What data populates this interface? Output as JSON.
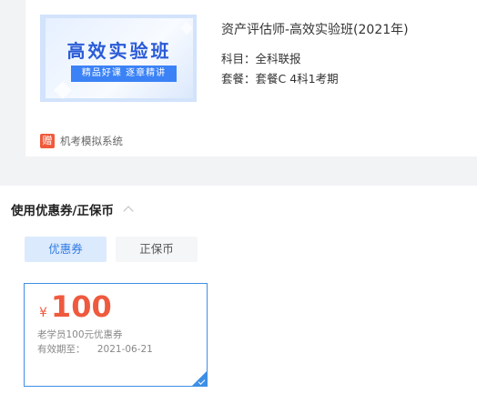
{
  "product": {
    "thumb_title": "高效实验班",
    "thumb_subtitle": "精品好课 逐章精讲",
    "title": "资产评估师-高效实验班(2021年)",
    "subject": "科目：全科联报",
    "package": "套餐：套餐C 4科1考期",
    "gift_badge": "赠",
    "gift_text": "机考模拟系统"
  },
  "coupons": {
    "section_title": "使用优惠券/正保币",
    "tabs": [
      {
        "label": "优惠券",
        "active": true
      },
      {
        "label": "正保币",
        "active": false
      }
    ],
    "items": [
      {
        "currency": "¥",
        "amount": "100",
        "description": "老学员100元优惠券",
        "expiry_label": "有效期至：",
        "expiry_date": "2021-06-21",
        "selected": true
      }
    ]
  },
  "colors": {
    "accent_blue": "#3d8fe6",
    "price_red": "#ef5a3e",
    "gift_orange": "#f05a3c"
  }
}
